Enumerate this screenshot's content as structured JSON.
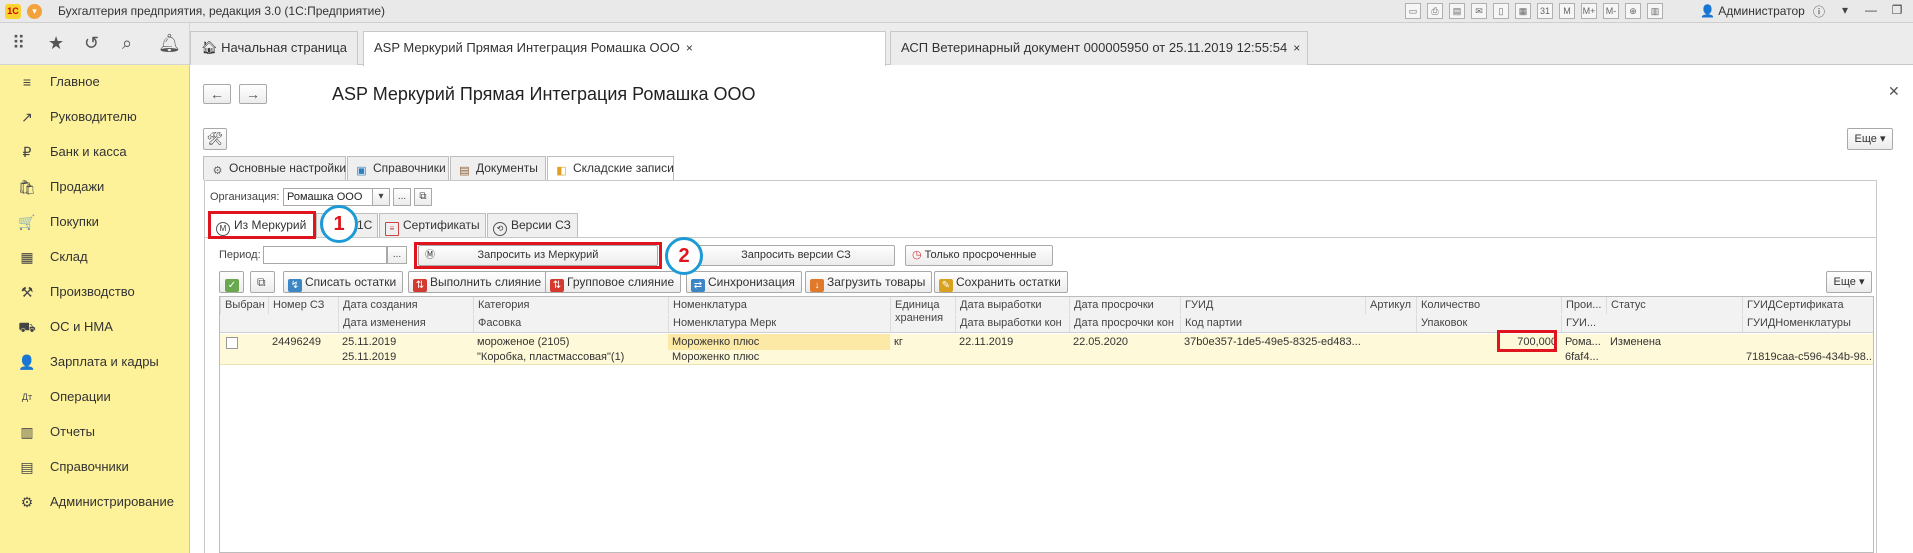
{
  "app": {
    "title": "Бухгалтерия предприятия, редакция 3.0  (1С:Предприятие)",
    "logo": "1С",
    "user": "Администратор",
    "tool_icons": [
      "save-icon",
      "print-icon",
      "print-preview-icon",
      "mail-icon",
      "doc-icon",
      "table-icon",
      "calendar-icon",
      "m-icon",
      "m-plus-icon",
      "m-minus-icon",
      "zoom-icon",
      "panel-icon"
    ],
    "window_controls": [
      "ⓘ",
      "▾",
      "—",
      "❐",
      "✕"
    ]
  },
  "open_tabs": [
    {
      "label": "Начальная страница",
      "close": ""
    },
    {
      "label": "ASP Меркурий Прямая Интеграция Ромашка ООО",
      "close": "×"
    },
    {
      "label": "АСП Ветеринарный документ 000005950 от 25.11.2019 12:55:54",
      "close": "×"
    }
  ],
  "sidebar": {
    "items": [
      {
        "label": "Главное",
        "icon": "≡"
      },
      {
        "label": "Руководителю",
        "icon": "↗"
      },
      {
        "label": "Банк и касса",
        "icon": "₽"
      },
      {
        "label": "Продажи",
        "icon": "🛍"
      },
      {
        "label": "Покупки",
        "icon": "🛒"
      },
      {
        "label": "Склад",
        "icon": "▦"
      },
      {
        "label": "Производство",
        "icon": "⚒"
      },
      {
        "label": "ОС и НМА",
        "icon": "⛟"
      },
      {
        "label": "Зарплата и кадры",
        "icon": "👤"
      },
      {
        "label": "Операции",
        "icon": "Дт"
      },
      {
        "label": "Отчеты",
        "icon": "▥"
      },
      {
        "label": "Справочники",
        "icon": "▤"
      },
      {
        "label": "Администрирование",
        "icon": "⚙"
      }
    ]
  },
  "page": {
    "title": "ASP Меркурий Прямая Интеграция Ромашка ООО",
    "more_label": "Еще ▾",
    "form_tabs": [
      {
        "label": "Основные настройки",
        "icon": "⚙"
      },
      {
        "label": "Справочники",
        "icon": "▣"
      },
      {
        "label": "Документы",
        "icon": "▤"
      },
      {
        "label": "Складские записи",
        "icon": "◧"
      }
    ],
    "org_label": "Организация:",
    "org_value": "Ромашка ООО",
    "inner_tabs": [
      {
        "label": "Из Меркурий",
        "icon": "M"
      },
      {
        "label": "1С",
        "icon": ""
      },
      {
        "label": "Сертификаты",
        "icon": ""
      },
      {
        "label": "Версии СЗ",
        "icon": ""
      }
    ],
    "period_label": "Период:",
    "period_value": "",
    "request_button": "Запросить из Меркурий",
    "versions_button": "Запросить версии СЗ",
    "expired_button": "Только просроченные",
    "actions": [
      {
        "label": "Списать остатки",
        "icon_color": "#3d86c6"
      },
      {
        "label": "Выполнить слияние",
        "icon_color": "#d43a2f"
      },
      {
        "label": "Групповое слияние",
        "icon_color": "#d43a2f"
      },
      {
        "label": "Синхронизация",
        "icon_color": "#3d86c6"
      },
      {
        "label": "Загрузить товары",
        "icon_color": "#e07a2a"
      },
      {
        "label": "Сохранить остатки",
        "icon_color": "#d9a21e"
      }
    ],
    "grid_more": "Еще ▾",
    "markers": [
      "1",
      "2"
    ]
  },
  "grid": {
    "header_row1": [
      "Выбран",
      "Номер СЗ",
      "Дата создания",
      "Категория",
      "Номенклатура",
      "Единица хранения",
      "Дата выработки",
      "Дата просрочки",
      "ГУИД",
      "Артикул",
      "Количество",
      "Прои...",
      "Статус",
      "ГУИДСертификата"
    ],
    "header_row2": [
      "",
      "",
      "Дата изменения",
      "Фасовка",
      "Номенклатура Мерк",
      "",
      "Дата выработки кон",
      "Дата просрочки кон",
      "Код партии",
      "",
      "Упаковок",
      "ГУИ...",
      "",
      "ГУИДНоменклатуры"
    ],
    "rows": [
      {
        "line1": [
          "",
          "24496249",
          "25.11.2019",
          "мороженое (2105)",
          "Мороженко плюс",
          "кг",
          "22.11.2019",
          "22.05.2020",
          "37b0e357-1de5-49e5-8325-ed483...",
          "",
          "700,000",
          "Рома...",
          "Изменена",
          ""
        ],
        "line2": [
          "",
          "",
          "25.11.2019",
          "\"Коробка, пластмассовая\"(1)",
          "Мороженко плюс",
          "",
          "",
          "",
          "",
          "",
          "",
          "6faf4...",
          "",
          "71819caa-c596-434b-98..."
        ]
      }
    ]
  },
  "colors": {
    "sidebar_bg": "#fdf29a",
    "highlight_row": "#fef9d8",
    "highlight_cell": "#fde9a6",
    "annotation_red": "#e0141e",
    "annotation_blue": "#1c9ad6"
  }
}
